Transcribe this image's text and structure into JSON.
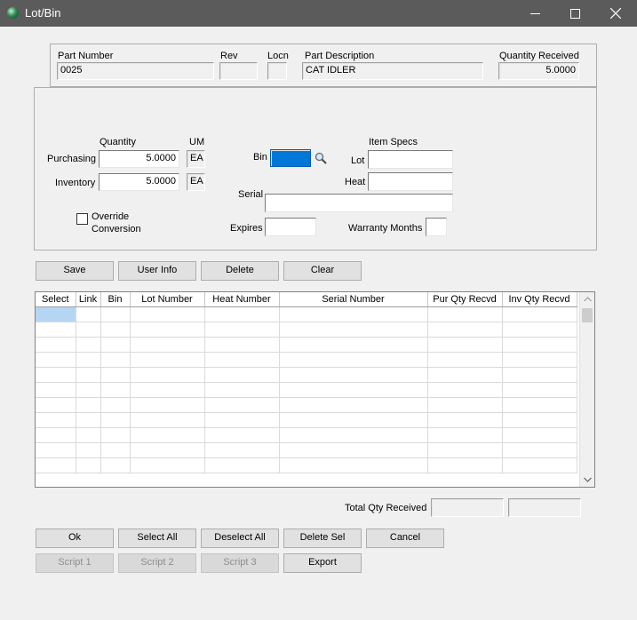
{
  "window": {
    "title": "Lot/Bin",
    "icons": {
      "app": "app-orb-icon",
      "minimize": "minimize-icon",
      "maximize": "maximize-icon",
      "close": "close-icon"
    }
  },
  "header": {
    "part_number_label": "Part Number",
    "part_number_value": "0025",
    "rev_label": "Rev",
    "rev_value": "",
    "locn_label": "Locn",
    "locn_value": "",
    "part_description_label": "Part Description",
    "part_description_value": "CAT IDLER",
    "quantity_received_label": "Quantity Received",
    "quantity_received_value": "5.0000"
  },
  "details": {
    "quantity_header": "Quantity",
    "um_header": "UM",
    "purchasing_label": "Purchasing",
    "purchasing_qty": "5.0000",
    "purchasing_um": "EA",
    "inventory_label": "Inventory",
    "inventory_qty": "5.0000",
    "inventory_um": "EA",
    "override_label_line1": "Override",
    "override_label_line2": "Conversion",
    "bin_label": "Bin",
    "bin_value": "",
    "item_specs_header": "Item Specs",
    "lot_label": "Lot",
    "lot_value": "",
    "heat_label": "Heat",
    "heat_value": "",
    "serial_label": "Serial",
    "serial_value": "",
    "expires_label": "Expires",
    "expires_value": "",
    "warranty_label": "Warranty Months",
    "warranty_value": "",
    "icons": {
      "bin_lookup": "magnifier-icon"
    }
  },
  "actions": {
    "save": "Save",
    "user_info": "User Info",
    "delete": "Delete",
    "clear": "Clear"
  },
  "grid": {
    "columns": [
      "Select",
      "Link",
      "Bin",
      "Lot Number",
      "Heat Number",
      "Serial Number",
      "Pur Qty Recvd",
      "Inv Qty Recvd"
    ],
    "rows": 11
  },
  "totals": {
    "label": "Total Qty Received",
    "value1": "",
    "value2": ""
  },
  "bottom": {
    "ok": "Ok",
    "select_all": "Select All",
    "deselect_all": "Deselect All",
    "delete_sel": "Delete Sel",
    "cancel": "Cancel",
    "script1": "Script 1",
    "script2": "Script 2",
    "script3": "Script 3",
    "export": "Export"
  }
}
